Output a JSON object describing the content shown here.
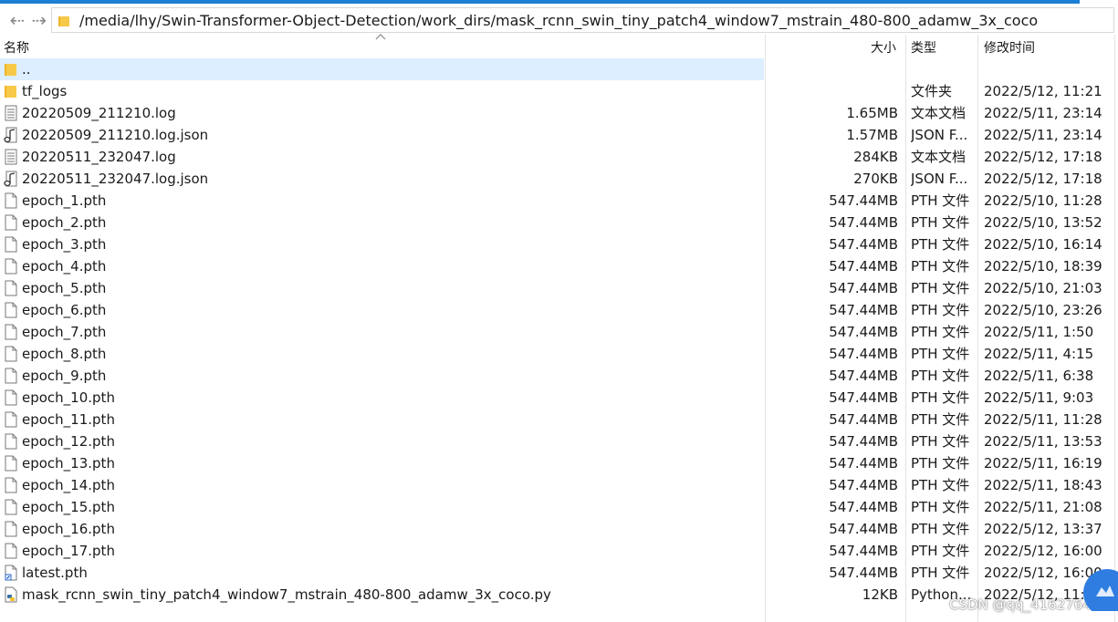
{
  "address": {
    "path": "/media/lhy/Swin-Transformer-Object-Detection/work_dirs/mask_rcnn_swin_tiny_patch4_window7_mstrain_480-800_adamw_3x_coco"
  },
  "columns": {
    "name": "名称",
    "size": "大小",
    "type": "类型",
    "modified": "修改时间"
  },
  "icons": {
    "back": "back-arrow-icon",
    "forward": "forward-arrow-icon",
    "folder": "folder-icon",
    "sort": "sort-ascending-icon"
  },
  "colors": {
    "accent": "#1a7fd5",
    "selection": "#dceeff",
    "folder": "#f7c948"
  },
  "files": [
    {
      "name": "..",
      "size": "",
      "type": "",
      "modified": "",
      "icon": "folder"
    },
    {
      "name": "tf_logs",
      "size": "",
      "type": "文件夹",
      "modified": "2022/5/12, 11:21",
      "icon": "folder"
    },
    {
      "name": "20220509_211210.log",
      "size": "1.65MB",
      "type": "文本文档",
      "modified": "2022/5/11, 23:14",
      "icon": "text"
    },
    {
      "name": "20220509_211210.log.json",
      "size": "1.57MB",
      "type": "JSON F...",
      "modified": "2022/5/11, 23:14",
      "icon": "json"
    },
    {
      "name": "20220511_232047.log",
      "size": "284KB",
      "type": "文本文档",
      "modified": "2022/5/12, 17:18",
      "icon": "text"
    },
    {
      "name": "20220511_232047.log.json",
      "size": "270KB",
      "type": "JSON F...",
      "modified": "2022/5/12, 17:18",
      "icon": "json"
    },
    {
      "name": "epoch_1.pth",
      "size": "547.44MB",
      "type": "PTH 文件",
      "modified": "2022/5/10, 11:28",
      "icon": "file"
    },
    {
      "name": "epoch_2.pth",
      "size": "547.44MB",
      "type": "PTH 文件",
      "modified": "2022/5/10, 13:52",
      "icon": "file"
    },
    {
      "name": "epoch_3.pth",
      "size": "547.44MB",
      "type": "PTH 文件",
      "modified": "2022/5/10, 16:14",
      "icon": "file"
    },
    {
      "name": "epoch_4.pth",
      "size": "547.44MB",
      "type": "PTH 文件",
      "modified": "2022/5/10, 18:39",
      "icon": "file"
    },
    {
      "name": "epoch_5.pth",
      "size": "547.44MB",
      "type": "PTH 文件",
      "modified": "2022/5/10, 21:03",
      "icon": "file"
    },
    {
      "name": "epoch_6.pth",
      "size": "547.44MB",
      "type": "PTH 文件",
      "modified": "2022/5/10, 23:26",
      "icon": "file"
    },
    {
      "name": "epoch_7.pth",
      "size": "547.44MB",
      "type": "PTH 文件",
      "modified": "2022/5/11, 1:50",
      "icon": "file"
    },
    {
      "name": "epoch_8.pth",
      "size": "547.44MB",
      "type": "PTH 文件",
      "modified": "2022/5/11, 4:15",
      "icon": "file"
    },
    {
      "name": "epoch_9.pth",
      "size": "547.44MB",
      "type": "PTH 文件",
      "modified": "2022/5/11, 6:38",
      "icon": "file"
    },
    {
      "name": "epoch_10.pth",
      "size": "547.44MB",
      "type": "PTH 文件",
      "modified": "2022/5/11, 9:03",
      "icon": "file"
    },
    {
      "name": "epoch_11.pth",
      "size": "547.44MB",
      "type": "PTH 文件",
      "modified": "2022/5/11, 11:28",
      "icon": "file"
    },
    {
      "name": "epoch_12.pth",
      "size": "547.44MB",
      "type": "PTH 文件",
      "modified": "2022/5/11, 13:53",
      "icon": "file"
    },
    {
      "name": "epoch_13.pth",
      "size": "547.44MB",
      "type": "PTH 文件",
      "modified": "2022/5/11, 16:19",
      "icon": "file"
    },
    {
      "name": "epoch_14.pth",
      "size": "547.44MB",
      "type": "PTH 文件",
      "modified": "2022/5/11, 18:43",
      "icon": "file"
    },
    {
      "name": "epoch_15.pth",
      "size": "547.44MB",
      "type": "PTH 文件",
      "modified": "2022/5/11, 21:08",
      "icon": "file"
    },
    {
      "name": "epoch_16.pth",
      "size": "547.44MB",
      "type": "PTH 文件",
      "modified": "2022/5/12, 13:37",
      "icon": "file"
    },
    {
      "name": "epoch_17.pth",
      "size": "547.44MB",
      "type": "PTH 文件",
      "modified": "2022/5/12, 16:00",
      "icon": "file"
    },
    {
      "name": "latest.pth",
      "size": "547.44MB",
      "type": "PTH 文件",
      "modified": "2022/5/12, 16:00",
      "icon": "shortcut"
    },
    {
      "name": "mask_rcnn_swin_tiny_patch4_window7_mstrain_480-800_adamw_3x_coco.py",
      "size": "12KB",
      "type": "Python...",
      "modified": "2022/5/12, 11:27",
      "icon": "python"
    }
  ],
  "selected_rows": [
    0,
    25
  ],
  "watermark": "CSDN @qq_41627642"
}
